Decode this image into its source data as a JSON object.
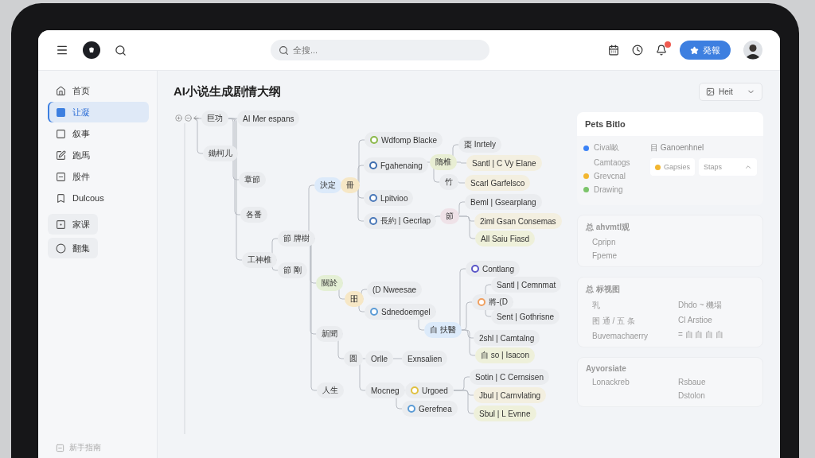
{
  "topbar": {
    "search": {
      "placeholder": "全搜..."
    },
    "create_button": "発報"
  },
  "sidebar": {
    "items": [
      {
        "label": "首页",
        "selected": false,
        "kind": "nav"
      },
      {
        "label": "让凝",
        "selected": true,
        "kind": "nav"
      },
      {
        "label": "叙事",
        "selected": false,
        "kind": "nav"
      },
      {
        "label": "跑馬",
        "selected": false,
        "kind": "nav"
      },
      {
        "label": "股件",
        "selected": false,
        "kind": "nav"
      },
      {
        "label": "Dulcous",
        "selected": false,
        "kind": "nav"
      },
      {
        "label": "家课",
        "selected": false,
        "kind": "pill"
      },
      {
        "label": "翻集",
        "selected": false,
        "kind": "pill"
      }
    ],
    "footer": "新手指南"
  },
  "page": {
    "title": "AI小说生成剧情大纲",
    "view_select": "Heit"
  },
  "mind_map": {
    "root": {
      "label": "巨功",
      "kind": "plain",
      "children": [
        {
          "label": "AI Mer espans",
          "kind": "plain"
        },
        {
          "label": "鋤柯儿",
          "kind": "plain"
        },
        {
          "label": "章節",
          "kind": "plain"
        },
        {
          "label": "各番",
          "kind": "plain"
        },
        {
          "label": "工神椎",
          "kind": "plain",
          "children": [
            {
              "label": "節 牌樹",
              "kind": "plain",
              "children": [
                {
                  "label": "決定",
                  "kind": "tinted",
                  "color": "#dceafa",
                  "children": [
                    {
                      "label": "冊",
                      "kind": "tinted",
                      "color": "#f6e7c6",
                      "children": [
                        {
                          "label": "Wdfomp Blacke",
                          "kind": "icon",
                          "color": "#8bb84a"
                        },
                        {
                          "label": "Fgahenaing",
                          "kind": "icon",
                          "color": "#3f6fb0",
                          "children": [
                            {
                              "label": "隋椎",
                              "kind": "tinted",
                              "color": "#e8eed3",
                              "children": [
                                {
                                  "label": "棗 Inrtely",
                                  "kind": "plain"
                                },
                                {
                                  "label": "Santl | C Vy Elane",
                                  "kind": "tinted",
                                  "color": "#f3efe0"
                                },
                                {
                                  "label": "竹",
                                  "kind": "plain",
                                  "children": [
                                    {
                                      "label": "Scarl Garfelsco",
                                      "kind": "tinted",
                                      "color": "#f3efe0"
                                    }
                                  ]
                                }
                              ]
                            }
                          ]
                        },
                        {
                          "label": "Lpitvioo",
                          "kind": "icon",
                          "color": "#4a78b8"
                        },
                        {
                          "label": "長約 | Gecrlap",
                          "kind": "icon",
                          "color": "#4a78b8",
                          "children": [
                            {
                              "label": "節",
                              "kind": "tinted",
                              "color": "#efe2e8",
                              "children": [
                                {
                                  "label": "Beml | Gsearplang",
                                  "kind": "plain"
                                },
                                {
                                  "label": "2iml Gsan Consemas",
                                  "kind": "tinted",
                                  "color": "#f3efe0"
                                },
                                {
                                  "label": "All Saiu Fiasd",
                                  "kind": "tinted",
                                  "color": "#eef0da"
                                }
                              ]
                            }
                          ]
                        }
                      ]
                    }
                  ]
                },
                {
                  "label": "關於",
                  "kind": "tinted",
                  "color": "#e4efd5",
                  "children": [
                    {
                      "label": "昍",
                      "kind": "tinted",
                      "color": "#f6e7c6",
                      "children": [
                        {
                          "label": "(D Nweesae",
                          "kind": "plain"
                        },
                        {
                          "label": "Sdnedoemgel",
                          "kind": "icon",
                          "color": "#5b9bd5",
                          "children": [
                            {
                              "label": "自 扶醫",
                              "kind": "tinted",
                              "color": "#dceafa",
                              "children": [
                                {
                                  "label": "Contlang",
                                  "kind": "icon",
                                  "color": "#5a56c8"
                                },
                                {
                                  "label": "將-(D",
                                  "kind": "icon",
                                  "color": "#f0a060",
                                  "children": [
                                    {
                                      "label": "Santl | Cemnmat",
                                      "kind": "plain"
                                    },
                                    {
                                      "label": "Sent | Gothrisne",
                                      "kind": "plain"
                                    }
                                  ]
                                },
                                {
                                  "label": "2shl | Camtalng",
                                  "kind": "plain"
                                },
                                {
                                  "label": "自 so | Isacon",
                                  "kind": "tinted",
                                  "color": "#eef0da"
                                }
                              ]
                            }
                          ]
                        }
                      ]
                    }
                  ]
                },
                {
                  "label": "新聞",
                  "kind": "plain",
                  "children": [
                    {
                      "label": "圆",
                      "kind": "plain",
                      "children": [
                        {
                          "label": "Orlle",
                          "kind": "plain",
                          "children": [
                            {
                              "label": "Exnsalien",
                              "kind": "plain"
                            }
                          ]
                        },
                        {
                          "label": "Mocneg",
                          "kind": "plain",
                          "children": [
                            {
                              "label": "Urgoed",
                              "kind": "icon",
                              "color": "#e0c040",
                              "children": [
                                {
                                  "label": "Sotin | C Cernsisen",
                                  "kind": "plain"
                                },
                                {
                                  "label": "Jbul | Carnvlating",
                                  "kind": "tinted",
                                  "color": "#f3efe0"
                                },
                                {
                                  "label": "Sbul | L Evnne",
                                  "kind": "tinted",
                                  "color": "#eef0da"
                                }
                              ]
                            },
                            {
                              "label": "Gerefnea",
                              "kind": "icon",
                              "color": "#5b9bd5"
                            }
                          ]
                        }
                      ]
                    }
                  ]
                },
                {
                  "label": "人生",
                  "kind": "plain"
                }
              ]
            },
            {
              "label": "節 剛",
              "kind": "plain"
            }
          ]
        }
      ]
    }
  },
  "panel": {
    "properties": {
      "title": "Pets Bitlo",
      "legend": [
        {
          "label": "Cival畝",
          "sub": "Camtaogs",
          "color": "#3b82f6"
        },
        {
          "label": "Grevcnal",
          "color": "#f2b630"
        },
        {
          "label": "Drawing",
          "color": "#7cc46a"
        }
      ],
      "group": "目 Ganoenhnel",
      "chip": "Gapsies",
      "select": "Staps"
    },
    "cards": [
      {
        "title": "总 ahvmtl观",
        "left": [
          "Cpripn",
          "Fpeme"
        ]
      },
      {
        "title": "总 标视图",
        "left": [
          "乳",
          "图 通 / 五 条",
          "Buvemachaerry"
        ],
        "right": [
          "Dhdo ~ 機場",
          "Cl Arstioe",
          "= 自 自 自 自"
        ]
      },
      {
        "title": "Ayvorsiate",
        "left": [
          "Lonackreb"
        ],
        "right": [
          "Rsbaue",
          "Dstolon"
        ]
      }
    ]
  }
}
